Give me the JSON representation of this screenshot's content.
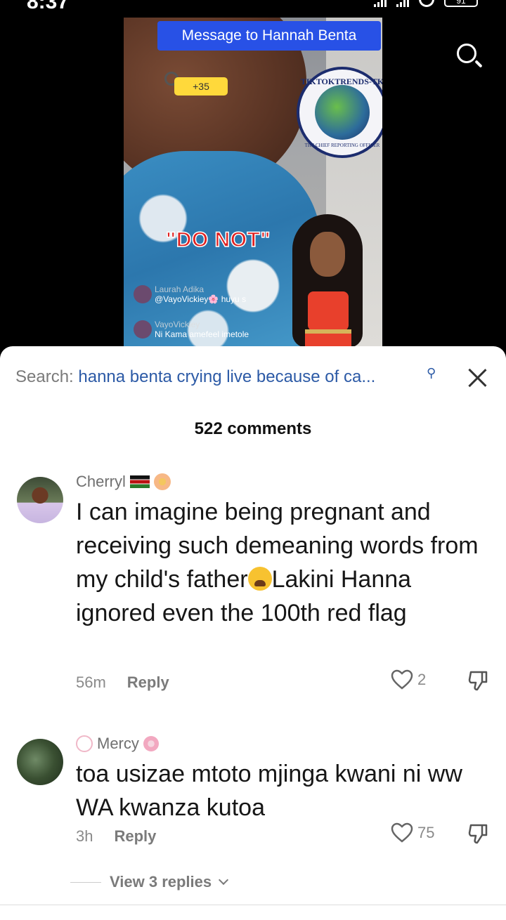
{
  "status": {
    "time": "8:37",
    "battery": "91"
  },
  "video": {
    "banner": "Message to Hannah Benta",
    "gift_count": "+35",
    "badge_top": "TIKTOKTRENDS-TK",
    "badge_bottom": "THE CHIEF REPORTING OFFICER",
    "overlay_text": "\"DO NOT\"",
    "live_comments": [
      {
        "user": "Laurah Adika",
        "text": "@VayoVickiey🌸 huyu s"
      },
      {
        "user": "VayoVickiey",
        "text": "Ni Kama amefeel imetole"
      }
    ]
  },
  "search": {
    "prefix": "Search:",
    "query": "hanna benta crying live because of ca..."
  },
  "comments_header": {
    "count_label": "522 comments"
  },
  "comments": [
    {
      "user": "Cherryl",
      "text_a": "I can imagine being pregnant and receiving such demeaning words from my child's father",
      "text_b": "Lakini Hanna ignored even the 100th red flag",
      "time": "56m",
      "reply": "Reply",
      "likes": "2"
    },
    {
      "user": "Mercy",
      "text": "toa usizae mtoto mjinga kwani ni ww WA kwanza kutoa",
      "time": "3h",
      "reply": "Reply",
      "likes": "75",
      "view_replies": "View 3 replies"
    }
  ],
  "colors": {
    "accent": "#2851e6",
    "link": "#2c5aa6",
    "overlay": "#e02020"
  }
}
